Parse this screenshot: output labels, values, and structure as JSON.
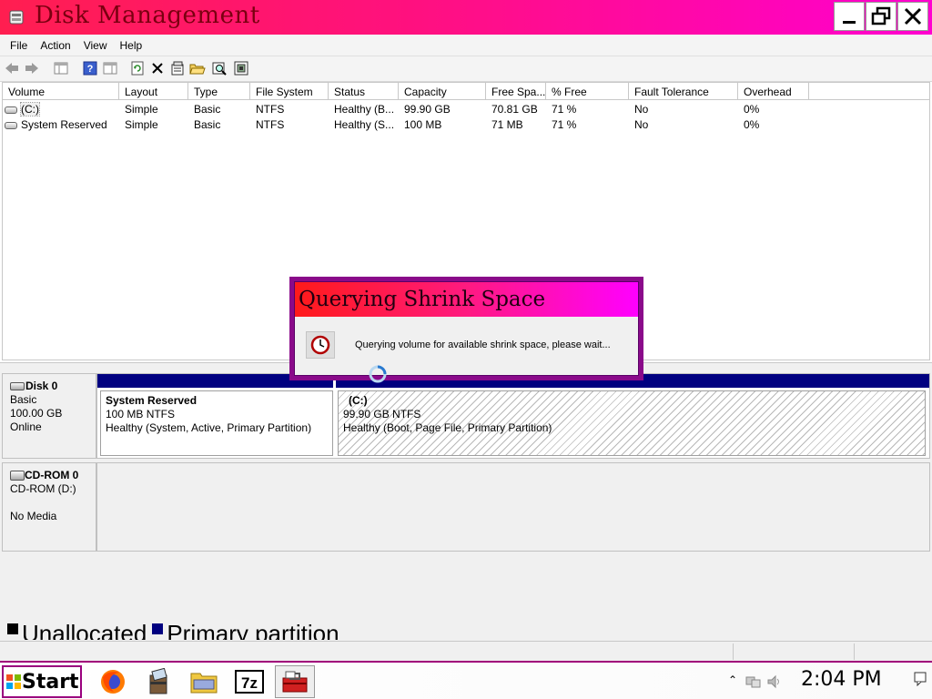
{
  "window": {
    "title": "Disk Management"
  },
  "menu": [
    "File",
    "Action",
    "View",
    "Help"
  ],
  "columns": [
    "Volume",
    "Layout",
    "Type",
    "File System",
    "Status",
    "Capacity",
    "Free Spa...",
    "% Free",
    "Fault Tolerance",
    "Overhead"
  ],
  "rows": [
    {
      "volume": "(C:)",
      "layout": "Simple",
      "type": "Basic",
      "fs": "NTFS",
      "status": "Healthy (B...",
      "capacity": "99.90 GB",
      "free": "70.81 GB",
      "pct": "71 %",
      "fault": "No",
      "overhead": "0%"
    },
    {
      "volume": "System Reserved",
      "layout": "Simple",
      "type": "Basic",
      "fs": "NTFS",
      "status": "Healthy (S...",
      "capacity": "100 MB",
      "free": "71 MB",
      "pct": "71 %",
      "fault": "No",
      "overhead": "0%"
    }
  ],
  "disks": {
    "disk0": {
      "name": "Disk 0",
      "type": "Basic",
      "size": "100.00 GB",
      "state": "Online"
    },
    "cdrom": {
      "name": "CD-ROM 0",
      "drive": "CD-ROM (D:)",
      "media": "No Media"
    }
  },
  "partitions": {
    "reserved": {
      "name": "System Reserved",
      "size": "100 MB NTFS",
      "status": "Healthy (System, Active, Primary Partition)"
    },
    "c": {
      "name": "(C:)",
      "size": "99.90 GB NTFS",
      "status": "Healthy (Boot, Page File, Primary Partition)"
    }
  },
  "legend": {
    "unallocated": "Unallocated",
    "primary": "Primary partition"
  },
  "dialog": {
    "title": "Querying Shrink Space",
    "message": "Querying volume for available shrink space, please wait..."
  },
  "taskbar": {
    "start": "Start",
    "clock": "2:04 PM"
  },
  "colors": {
    "title_bar": "#ff1080",
    "primary_partition": "#000080",
    "dialog_border": "#8a0a8a"
  }
}
